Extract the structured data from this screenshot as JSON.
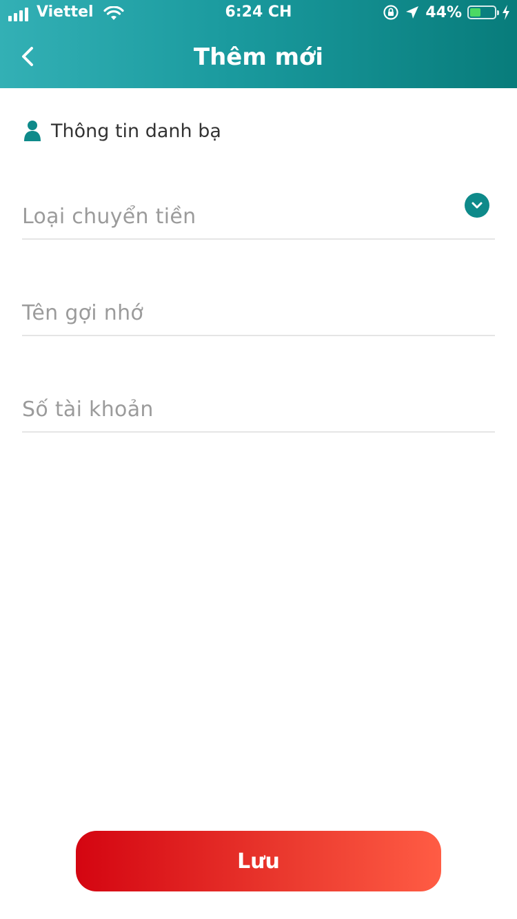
{
  "status_bar": {
    "carrier": "Viettel",
    "time": "6:24 CH",
    "battery_text": "44%",
    "battery_level": 0.44
  },
  "header": {
    "title": "Thêm mới"
  },
  "section": {
    "label": "Thông tin danh bạ"
  },
  "form": {
    "transfer_type_placeholder": "Loại chuyển tiền",
    "nickname_placeholder": "Tên gợi nhớ",
    "account_number_placeholder": "Số tài khoản"
  },
  "actions": {
    "save_label": "Lưu"
  },
  "colors": {
    "header_start": "#33b0b5",
    "header_end": "#087c7b",
    "accent": "#0e8a8a",
    "button_start": "#d40511",
    "button_end": "#ff5c44"
  }
}
